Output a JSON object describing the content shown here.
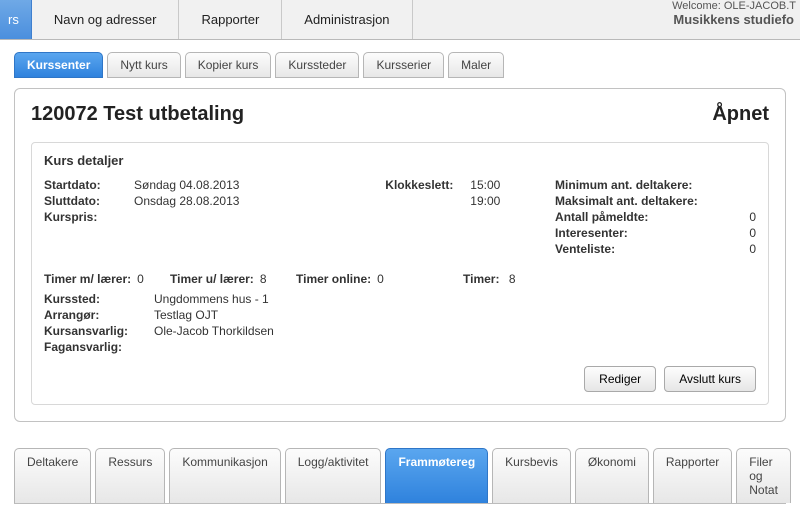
{
  "welcome": "Welcome: OLE-JACOB.T",
  "mainnav": {
    "tabs": [
      {
        "label": "rs"
      },
      {
        "label": "Navn og adresser"
      },
      {
        "label": "Rapporter"
      },
      {
        "label": "Administrasjon"
      }
    ],
    "brand": "Musikkens studiefo"
  },
  "subtabs": [
    {
      "label": "Kurssenter",
      "active": true
    },
    {
      "label": "Nytt kurs"
    },
    {
      "label": "Kopier kurs"
    },
    {
      "label": "Kurssteder"
    },
    {
      "label": "Kursserier"
    },
    {
      "label": "Maler"
    }
  ],
  "course": {
    "title": "120072 Test utbetaling",
    "status": "Åpnet"
  },
  "details": {
    "heading": "Kurs detaljer",
    "start_label": "Startdato:",
    "start": "Søndag 04.08.2013",
    "end_label": "Sluttdato:",
    "end": "Onsdag 28.08.2013",
    "price_label": "Kurspris:",
    "price": "",
    "time_label": "Klokkeslett:",
    "time_start": "15:00",
    "time_end": "19:00",
    "min_part_label": "Minimum ant. deltakere:",
    "min_part": "",
    "max_part_label": "Maksimalt ant. deltakere:",
    "max_part": "",
    "enrolled_label": "Antall påmeldte:",
    "enrolled": "0",
    "interested_label": "Interesenter:",
    "interested": "0",
    "waitlist_label": "Venteliste:",
    "waitlist": "0",
    "hrswith_label": "Timer m/ lærer:",
    "hrswith": "0",
    "hrswithout_label": "Timer u/ lærer:",
    "hrswithout": "8",
    "hrsonline_label": "Timer online:",
    "hrsonline": "0",
    "hrs_label": "Timer:",
    "hrs": "8",
    "place_label": "Kurssted:",
    "place": "Ungdommens hus - 1",
    "org_label": "Arrangør:",
    "org": "Testlag OJT",
    "resp_label": "Kursansvarlig:",
    "resp": "Ole-Jacob Thorkildsen",
    "fac_label": "Fagansvarlig:",
    "fac": ""
  },
  "actions": {
    "edit": "Rediger",
    "close": "Avslutt kurs"
  },
  "bottomtabs": [
    {
      "label": "Deltakere"
    },
    {
      "label": "Ressurs"
    },
    {
      "label": "Kommunikasjon"
    },
    {
      "label": "Logg/aktivitet"
    },
    {
      "label": "Frammøtereg",
      "active": true
    },
    {
      "label": "Kursbevis"
    },
    {
      "label": "Økonomi"
    },
    {
      "label": "Rapporter"
    },
    {
      "label": "Filer og Notat"
    }
  ]
}
